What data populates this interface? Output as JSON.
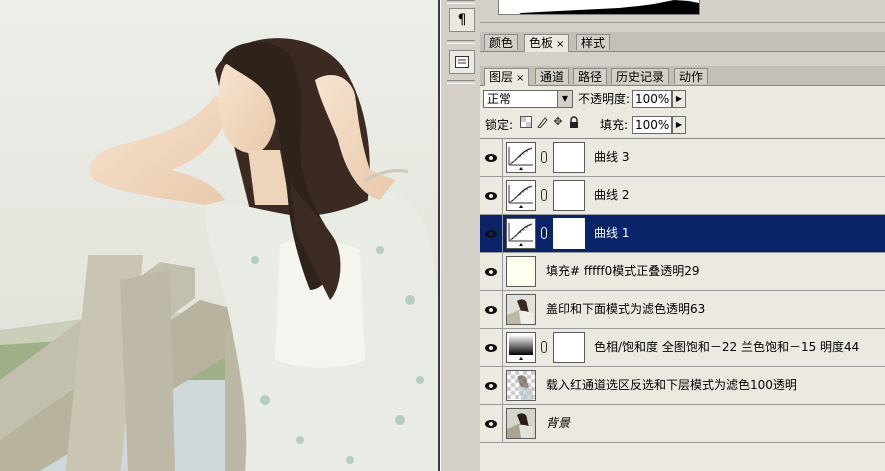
{
  "colors": {
    "panel_bg": "#d4d0c8",
    "selected_layer_bg": "#0a246a",
    "selected_layer_text": "#ffffff"
  },
  "top_tabs": [
    {
      "label": "颜色",
      "active": false
    },
    {
      "label": "色板",
      "active": true,
      "close": "×"
    },
    {
      "label": "样式",
      "active": false
    }
  ],
  "layer_tabs": [
    {
      "label": "图层",
      "active": true,
      "close": "×"
    },
    {
      "label": "通道",
      "active": false
    },
    {
      "label": "路径",
      "active": false
    },
    {
      "label": "历史记录",
      "active": false
    },
    {
      "label": "动作",
      "active": false
    }
  ],
  "blend_mode": "正常",
  "opacity_label": "不透明度:",
  "opacity_value": "100%",
  "lock_label": "锁定:",
  "fill_label": "填充:",
  "fill_value": "100%",
  "icons": [
    "eye-icon",
    "link-icon",
    "paragraph-icon",
    "panel-icon",
    "lock-icon",
    "brush-icon",
    "move-icon",
    "transparency-lock-icon"
  ],
  "layers": [
    {
      "name": "曲线 3",
      "thumb": "curves",
      "has_mask": true,
      "selected": false
    },
    {
      "name": "曲线 2",
      "thumb": "curves",
      "has_mask": true,
      "selected": false
    },
    {
      "name": "曲线 1",
      "thumb": "curves",
      "has_mask": true,
      "selected": true
    },
    {
      "name": "填充# fffff0模式正叠透明29",
      "thumb": "fill",
      "thumb_color": "#fffff0",
      "has_mask": false,
      "selected": false
    },
    {
      "name": "盖印和下面模式为滤色透明63",
      "thumb": "photo",
      "has_mask": false,
      "selected": false
    },
    {
      "name": "色相/饱和度 全图饱和－22  兰色饱和－15  明度44",
      "thumb": "gradient",
      "has_mask": true,
      "selected": false
    },
    {
      "name": "载入红通道选区反选和下层模式为滤色100透明",
      "thumb": "photo-transparent",
      "has_mask": false,
      "selected": false
    },
    {
      "name": "背景",
      "thumb": "photo",
      "has_mask": false,
      "selected": false,
      "italic": true
    }
  ]
}
